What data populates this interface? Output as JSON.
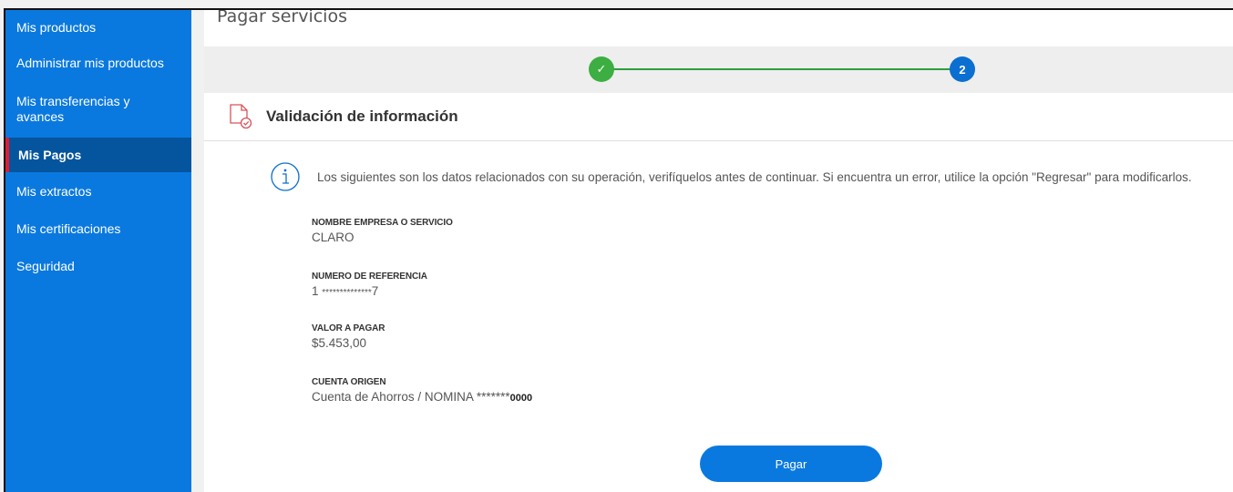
{
  "sidebar": {
    "items": [
      {
        "label": "Mis productos"
      },
      {
        "label": "Administrar mis productos"
      },
      {
        "label": "Mis transferencias y avances"
      },
      {
        "label": "Mis Pagos"
      },
      {
        "label": "Mis extractos"
      },
      {
        "label": "Mis certificaciones"
      },
      {
        "label": "Seguridad"
      }
    ],
    "active": "Mis Pagos"
  },
  "header": {
    "title": "Pagar servicios"
  },
  "stepper": {
    "steps": [
      {
        "label": "✓",
        "state": "done"
      },
      {
        "label": "2",
        "state": "current"
      }
    ]
  },
  "section": {
    "title": "Validación de información"
  },
  "info": {
    "text": "Los siguientes son los datos relacionados con su operación, verifíquelos antes de continuar. Si encuentra un error, utilice la opción \"Regresar\" para modificarlos."
  },
  "fields": {
    "empresa": {
      "label": "NOMBRE EMPRESA O SERVICIO",
      "value": "CLARO"
    },
    "referencia": {
      "label": "NUMERO DE REFERENCIA",
      "prefix": "1",
      "masked": "**************",
      "suffix": "7"
    },
    "valor": {
      "label": "VALOR A PAGAR",
      "value": "$5.453,00"
    },
    "cuenta": {
      "label": "CUENTA ORIGEN",
      "value": "Cuenta de Ahorros / NOMINA *******",
      "last4": "0000"
    }
  },
  "actions": {
    "pay_label": "Pagar"
  },
  "colors": {
    "primary": "#0a79df",
    "active_nav": "#04559d",
    "active_accent": "#e21b35",
    "step_done": "#3dae42"
  }
}
